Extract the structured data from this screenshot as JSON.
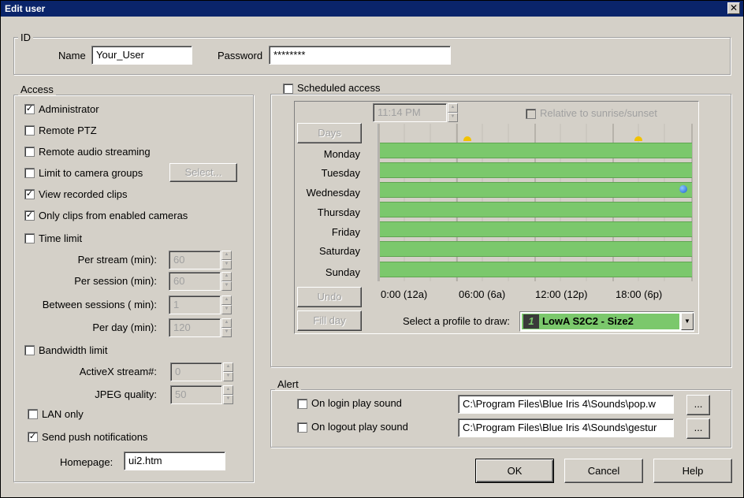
{
  "window": {
    "title": "Edit user",
    "close_glyph": "✕"
  },
  "id_group": {
    "legend": "ID",
    "name_label": "Name",
    "name_value": "Your_User",
    "password_label": "Password",
    "password_value": "********"
  },
  "access": {
    "legend": "Access",
    "administrator": {
      "label": "Administrator",
      "checked": true
    },
    "remote_ptz": {
      "label": "Remote PTZ",
      "checked": false
    },
    "remote_audio": {
      "label": "Remote audio streaming",
      "checked": false
    },
    "limit_groups": {
      "label": "Limit to camera groups",
      "checked": false
    },
    "select_button": "Select...",
    "view_clips": {
      "label": "View recorded clips",
      "checked": true
    },
    "only_clips": {
      "label": "Only clips from enabled cameras",
      "checked": true
    },
    "time_limit": {
      "label": "Time limit",
      "checked": false
    },
    "per_stream": {
      "label": "Per stream (min):",
      "value": "60"
    },
    "per_session": {
      "label": "Per session (min):",
      "value": "60"
    },
    "between_sessions": {
      "label": "Between sessions ( min):",
      "value": "1"
    },
    "per_day": {
      "label": "Per day (min):",
      "value": "120"
    },
    "bandwidth_limit": {
      "label": "Bandwidth limit",
      "checked": false
    },
    "activex_stream": {
      "label": "ActiveX stream#:",
      "value": "0"
    },
    "jpeg_quality": {
      "label": "JPEG quality:",
      "value": "50"
    },
    "lan_only": {
      "label": "LAN only",
      "checked": false
    },
    "push_notifications": {
      "label": "Send push notifications",
      "checked": true
    },
    "homepage_label": "Homepage:",
    "homepage_value": "ui2.htm"
  },
  "schedule": {
    "legend": "Scheduled access",
    "checked": false,
    "time_value": "11:14 PM",
    "relative_label": "Relative to sunrise/sunset",
    "days_button": "Days",
    "days": [
      "Monday",
      "Tuesday",
      "Wednesday",
      "Thursday",
      "Friday",
      "Saturday",
      "Sunday"
    ],
    "time_axis": [
      "0:00 (12a)",
      "06:00 (6a)",
      "12:00 (12p)",
      "18:00 (6p)"
    ],
    "undo_button": "Undo",
    "fill_day_button": "Fill day",
    "profile_label": "Select a profile to draw:",
    "profile_value": "LowA S2C2 - Size2",
    "profile_number": "1",
    "bar_color": "#7bc86c"
  },
  "alert": {
    "legend": "Alert",
    "login": {
      "label": "On login play sound",
      "checked": false,
      "path": "C:\\Program Files\\Blue Iris 4\\Sounds\\pop.w"
    },
    "logout": {
      "label": "On logout play sound",
      "checked": false,
      "path": "C:\\Program Files\\Blue Iris 4\\Sounds\\gestur"
    },
    "browse_label": "..."
  },
  "buttons": {
    "ok": "OK",
    "cancel": "Cancel",
    "help": "Help"
  }
}
